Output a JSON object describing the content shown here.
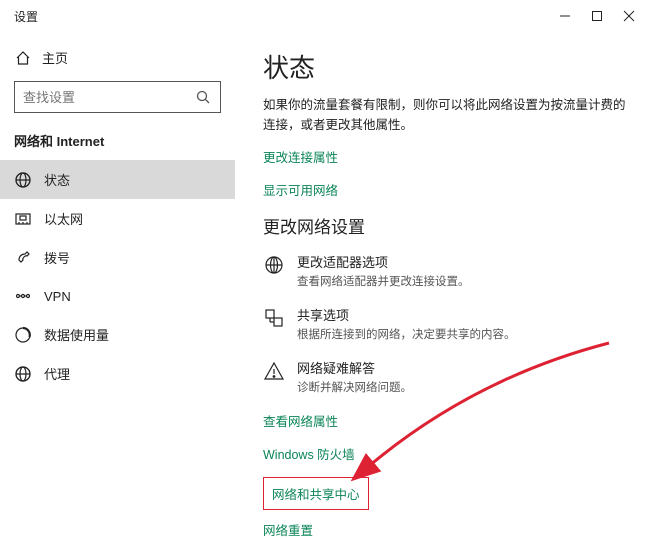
{
  "titlebar": {
    "title": "设置"
  },
  "sidebar": {
    "home_label": "主页",
    "search_placeholder": "查找设置",
    "section_title": "网络和 Internet",
    "items": [
      {
        "label": "状态"
      },
      {
        "label": "以太网"
      },
      {
        "label": "拨号"
      },
      {
        "label": "VPN"
      },
      {
        "label": "数据使用量"
      },
      {
        "label": "代理"
      }
    ]
  },
  "content": {
    "title": "状态",
    "desc": "如果你的流量套餐有限制，则你可以将此网络设置为按流量计费的连接，或者更改其他属性。",
    "link_change_conn": "更改连接属性",
    "link_show_networks": "显示可用网络",
    "h2": "更改网络设置",
    "opt_adapter_label": "更改适配器选项",
    "opt_adapter_sub": "查看网络适配器并更改连接设置。",
    "opt_sharing_label": "共享选项",
    "opt_sharing_sub": "根据所连接到的网络，决定要共享的内容。",
    "opt_troubleshoot_label": "网络疑难解答",
    "opt_troubleshoot_sub": "诊断并解决网络问题。",
    "link_view_props": "查看网络属性",
    "link_firewall": "Windows 防火墙",
    "link_sharing_center": "网络和共享中心",
    "link_reset": "网络重置"
  }
}
